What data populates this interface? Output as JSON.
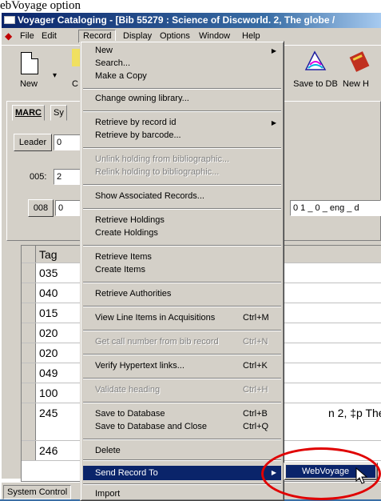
{
  "caption": "ebVoyage option",
  "title": "Voyager Cataloging - [Bib 55279 : Science of Discworld. 2, The globe /",
  "menubar": {
    "items": [
      "File",
      "Edit",
      "Record",
      "Display",
      "Options",
      "Window",
      "Help"
    ]
  },
  "toolbar": {
    "new_label": "New",
    "copy_label": "C",
    "save_db_label": "Save to DB",
    "new_h_label": "New H"
  },
  "tabs": [
    "MARC",
    "Sy"
  ],
  "leader_label": "Leader",
  "leader_value": "0",
  "f005_label": "005:",
  "f005_value": "2",
  "f008_label": "008",
  "f008_value": "0",
  "f008_tail": "0 1 _ 0 _ eng _ d",
  "grid": {
    "header": "Tag",
    "rows": [
      {
        "tag": "035",
        "val": ""
      },
      {
        "tag": "040",
        "val": ""
      },
      {
        "tag": "015",
        "val": ""
      },
      {
        "tag": "020",
        "val": ""
      },
      {
        "tag": "020",
        "val": ""
      },
      {
        "tag": "049",
        "val": ""
      },
      {
        "tag": "100",
        "val": ""
      },
      {
        "tag": "245",
        "val": "n 2, ‡p The glob"
      },
      {
        "tag": "246",
        "val": ""
      }
    ]
  },
  "status": {
    "system_control": "System Control"
  },
  "menu": {
    "items": [
      {
        "label": "New",
        "arrow": "▶"
      },
      {
        "label": "Search..."
      },
      {
        "label": "Make a Copy"
      },
      {
        "label": "Change owning library..."
      },
      {
        "label": "Retrieve by record id",
        "arrow": "▶"
      },
      {
        "label": "Retrieve by barcode..."
      },
      {
        "label": "Unlink holding from bibliographic...",
        "disabled": true
      },
      {
        "label": "Relink holding to bibliographic...",
        "disabled": true
      },
      {
        "label": "Show Associated Records..."
      },
      {
        "label": "Retrieve Holdings"
      },
      {
        "label": "Create Holdings"
      },
      {
        "label": "Retrieve Items"
      },
      {
        "label": "Create Items"
      },
      {
        "label": "Retrieve Authorities"
      },
      {
        "label": "View Line Items in Acquisitions",
        "shortcut": "Ctrl+M"
      },
      {
        "label": "Get call number from bib record",
        "shortcut": "Ctrl+N",
        "disabled": true
      },
      {
        "label": "Verify Hypertext links...",
        "shortcut": "Ctrl+K"
      },
      {
        "label": "Validate heading",
        "shortcut": "Ctrl+H",
        "disabled": true
      },
      {
        "label": "Save to Database",
        "shortcut": "Ctrl+B"
      },
      {
        "label": "Save to Database and Close",
        "shortcut": "Ctrl+Q"
      },
      {
        "label": "Delete"
      },
      {
        "label": "Send Record To",
        "arrow": "▶",
        "highlight": true
      },
      {
        "label": "Import"
      }
    ]
  },
  "submenu": {
    "label": "WebVoyage"
  },
  "colors": {
    "highlight": "#0a246a",
    "annotation": "#e00000"
  }
}
